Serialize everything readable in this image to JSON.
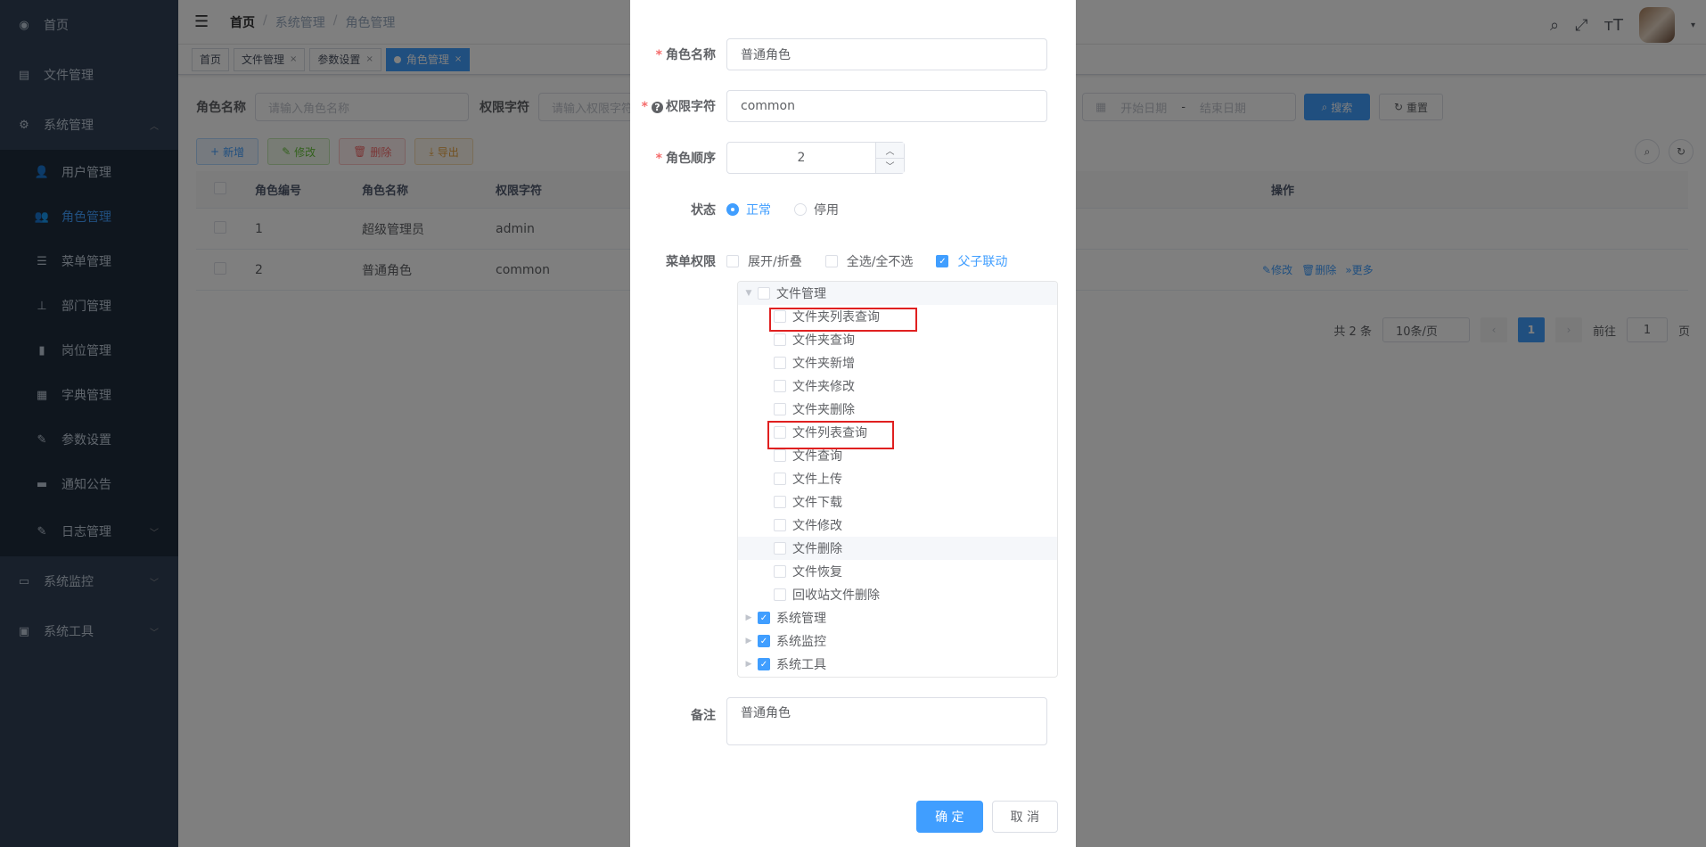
{
  "sidebar": {
    "items": [
      {
        "label": "首页",
        "icon": "dashboard-icon"
      },
      {
        "label": "文件管理",
        "icon": "file-icon"
      },
      {
        "label": "系统管理",
        "icon": "gear-icon"
      }
    ],
    "sub": [
      {
        "label": "用户管理",
        "icon": "user-icon"
      },
      {
        "label": "角色管理",
        "icon": "peoples-icon"
      },
      {
        "label": "菜单管理",
        "icon": "tree-table-icon"
      },
      {
        "label": "部门管理",
        "icon": "tree-icon"
      },
      {
        "label": "岗位管理",
        "icon": "post-icon"
      },
      {
        "label": "字典管理",
        "icon": "dict-icon"
      },
      {
        "label": "参数设置",
        "icon": "edit-icon"
      },
      {
        "label": "通知公告",
        "icon": "message-icon"
      },
      {
        "label": "日志管理",
        "icon": "log-icon"
      }
    ],
    "bottom": [
      {
        "label": "系统监控",
        "icon": "monitor-icon"
      },
      {
        "label": "系统工具",
        "icon": "tool-icon"
      }
    ]
  },
  "breadcrumb": [
    "首页",
    "系统管理",
    "角色管理"
  ],
  "tags": [
    "首页",
    "文件管理",
    "参数设置",
    "角色管理"
  ],
  "search": {
    "role_name_label": "角色名称",
    "role_name_placeholder": "请输入角色名称",
    "perm_label": "权限字符",
    "perm_placeholder": "请输入权限字符",
    "start_placeholder": "开始日期",
    "date_sep": "-",
    "end_placeholder": "结束日期",
    "search_btn": "搜索",
    "reset_btn": "重置"
  },
  "toolbar": {
    "add": "新增",
    "edit": "修改",
    "delete": "删除",
    "export": "导出"
  },
  "table": {
    "headers": [
      "角色编号",
      "角色名称",
      "权限字符",
      "操作"
    ],
    "rows": [
      {
        "id": "1",
        "name": "超级管理员",
        "key": "admin"
      },
      {
        "id": "2",
        "name": "普通角色",
        "key": "common"
      }
    ],
    "ops": [
      "修改",
      "删除",
      "更多"
    ]
  },
  "pager": {
    "total": "共 2 条",
    "size": "10条/页",
    "page": "1",
    "goto": "前往",
    "goto_value": "1",
    "unit": "页"
  },
  "dialog": {
    "role_name_label": "角色名称",
    "role_name_value": "普通角色",
    "perm_label": "权限字符",
    "perm_value": "common",
    "order_label": "角色顺序",
    "order_value": "2",
    "status_label": "状态",
    "status_on": "正常",
    "status_off": "停用",
    "menu_label": "菜单权限",
    "expand": "展开/折叠",
    "select_all": "全选/全不选",
    "linkage": "父子联动",
    "tree": {
      "root": "文件管理",
      "children": [
        "文件夹列表查询",
        "文件夹查询",
        "文件夹新增",
        "文件夹修改",
        "文件夹删除",
        "文件列表查询",
        "文件查询",
        "文件上传",
        "文件下载",
        "文件修改",
        "文件删除",
        "文件恢复",
        "回收站文件删除"
      ],
      "others": [
        "系统管理",
        "系统监控",
        "系统工具"
      ]
    },
    "remark_label": "备注",
    "remark_value": "普通角色",
    "ok": "确 定",
    "cancel": "取 消"
  },
  "colors": {
    "primary": "#409eff",
    "sidebar": "#304156",
    "highlight": "#e02020"
  }
}
